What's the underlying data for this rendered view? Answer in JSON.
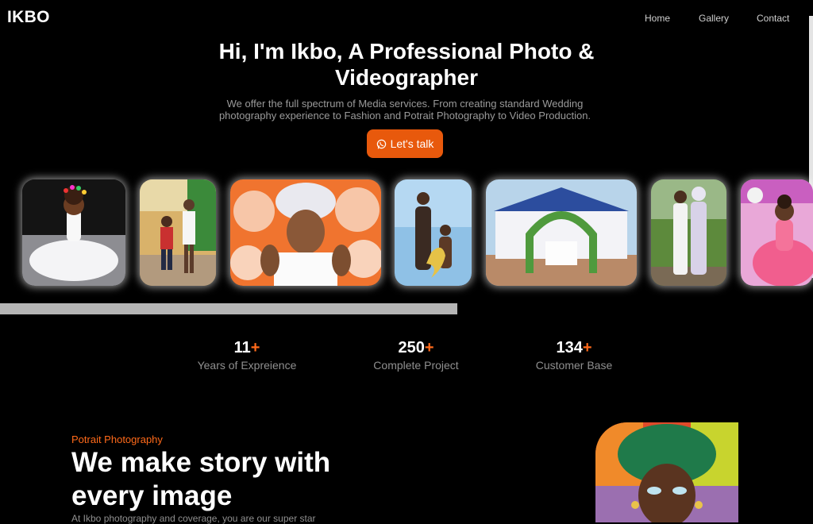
{
  "brand": {
    "logo": "IKBO"
  },
  "nav": {
    "items": [
      "Home",
      "Gallery",
      "Contact"
    ]
  },
  "hero": {
    "title": "Hi, I'm Ikbo, A Professional Photo & Videographer",
    "subtitle": "We offer the full spectrum of Media services. From creating standard Wedding photography experience to Fashion and Potrait Photography to Video Production.",
    "cta_label": "Let's talk",
    "cta_icon": "whatsapp-icon",
    "accent_color": "#e8590c"
  },
  "gallery": {
    "photos": [
      "child-white-dress-photo",
      "siblings-outdoor-photo",
      "bride-gele-portrait-photo",
      "mother-child-balloon-photo",
      "event-tent-arch-photo",
      "wedding-couple-photo",
      "girl-pink-dress-photo"
    ]
  },
  "stats": [
    {
      "value": "11",
      "suffix": "+",
      "label": "Years of Expreience"
    },
    {
      "value": "250",
      "suffix": "+",
      "label": "Complete Project"
    },
    {
      "value": "134",
      "suffix": "+",
      "label": "Customer Base"
    }
  ],
  "section": {
    "eyebrow": "Potrait Photography",
    "title": "We make story with every image",
    "text": "At Ikbo photography and coverage, you are our super star"
  }
}
